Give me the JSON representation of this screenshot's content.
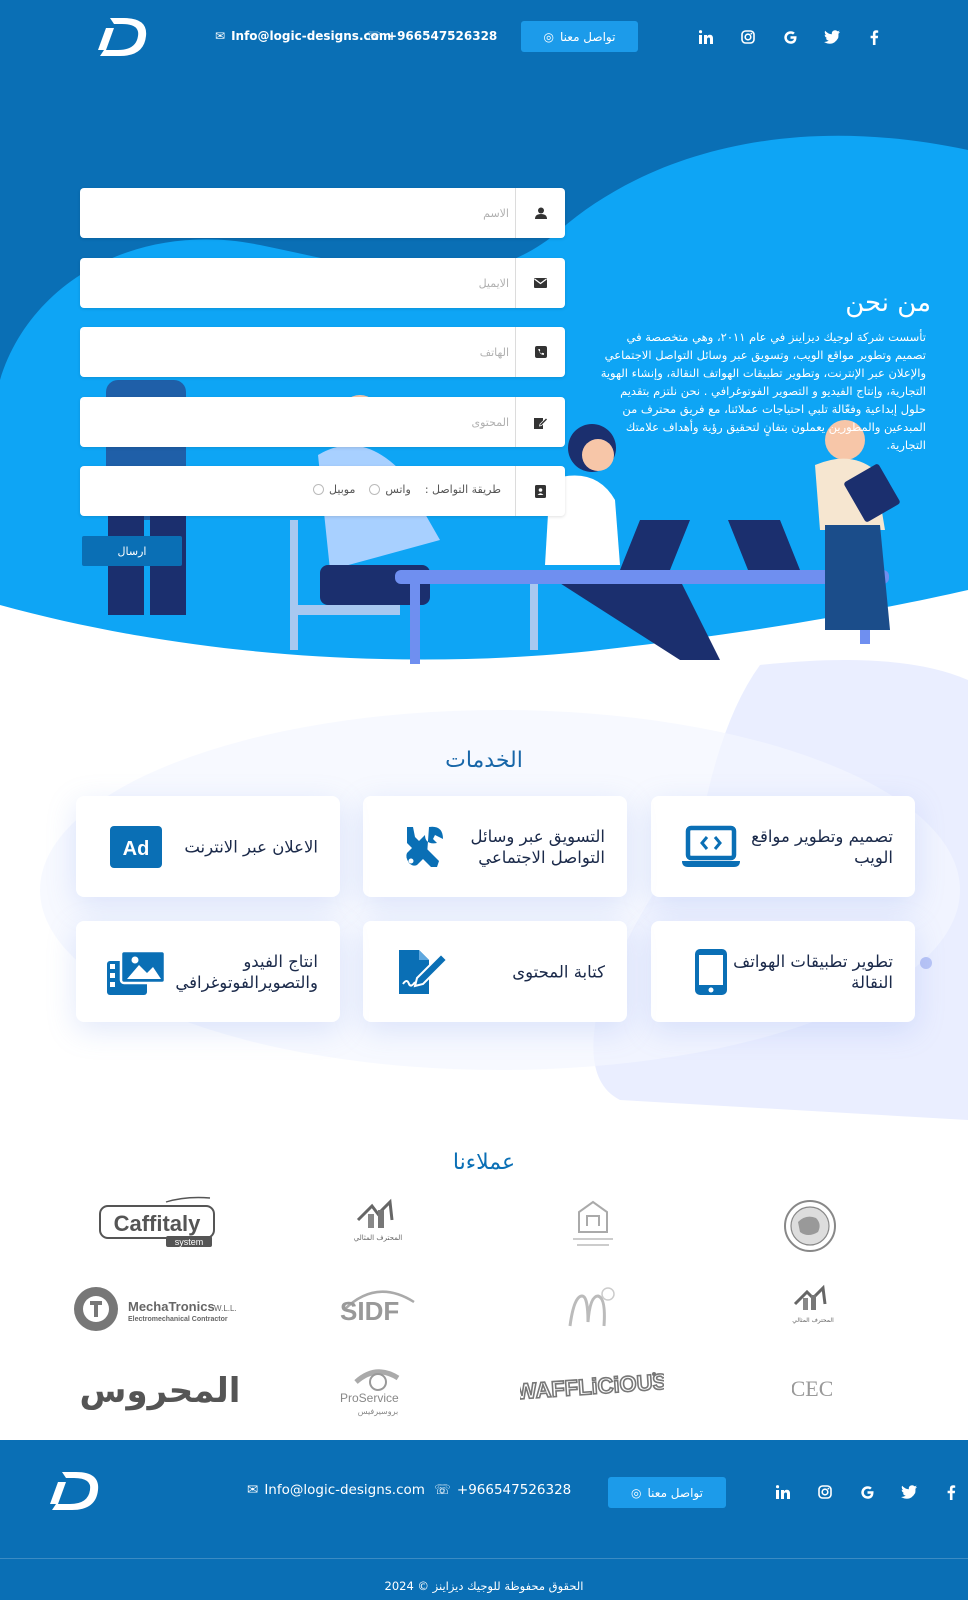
{
  "header": {
    "email": "Info@logic-designs.com",
    "phone": "+966547526328",
    "cta_label": "تواصل معنا",
    "social": [
      "linkedin-icon",
      "instagram-icon",
      "google-icon",
      "twitter-icon",
      "facebook-icon"
    ]
  },
  "form": {
    "name_placeholder": "الاسم",
    "email_placeholder": "الايميل",
    "phone_placeholder": "الهاتف",
    "content_placeholder": "المحتوى",
    "contact_method_label": "طريقة التواصل :",
    "contact_options": [
      "واتس",
      "موبيل"
    ],
    "submit_label": "ارسال"
  },
  "about": {
    "title": "من نحن",
    "text": "تأسست شركة لوجيك ديزاينز في عام ٢٠١١، وهي متخصصة في تصميم وتطوير مواقع الويب، وتسويق عبر وسائل التواصل الاجتماعي والإعلان عبر الإنترنت، وتطوير تطبيقات الهواتف النقالة، وإنشاء الهوية التجارية، وإنتاج الفيديو و التصوير الفوتوغرافي . نحن نلتزم بتقديم حلول إبداعية وفعّالة تلبي احتياجات عملائنا، مع فريق محترف من المبدعين والمطورين يعملون بتفانٍ لتحقيق رؤية وأهداف علامتك التجارية."
  },
  "services": {
    "title": "الخدمات",
    "items": [
      {
        "label": "تصميم وتطوير مواقع الويب",
        "icon": "web-code-icon"
      },
      {
        "label": "التسويق عبر وسائل التواصل الاجتماعي",
        "icon": "tools-icon"
      },
      {
        "label": "الاعلان عبر الانترنت",
        "icon": "ad-icon"
      },
      {
        "label": "تطوير تطبيقات الهواتف النقالة",
        "icon": "mobile-icon"
      },
      {
        "label": "كتابة المحتوى",
        "icon": "content-writing-icon"
      },
      {
        "label": "انتاج الفيدو والتصويرالفوتوغرافي",
        "icon": "video-photo-icon"
      }
    ]
  },
  "clients": {
    "title": "عملاءنا",
    "logos": [
      "Caffitaly system",
      "المحترف المثالي",
      "QASSIM Luxury Furniture",
      "seal",
      "MechaTronics W.L.L. Electromechanical Contractor",
      "SIDF",
      "M",
      "المحترف المثالي",
      "المحروس",
      "ProService بروسيرفيس",
      "WAFFLICIOUS",
      "CEC"
    ]
  },
  "footer": {
    "email": "Info@logic-designs.com",
    "phone": "+966547526328",
    "cta_label": "تواصل معنا",
    "copyright": "الحقوق محفوظة للوجيك ديزاينز © 2024"
  },
  "colors": {
    "primary": "#0a6fb5",
    "hero_light": "#0ea5f5",
    "accent": "#1c9bea",
    "title": "#1766a8"
  }
}
